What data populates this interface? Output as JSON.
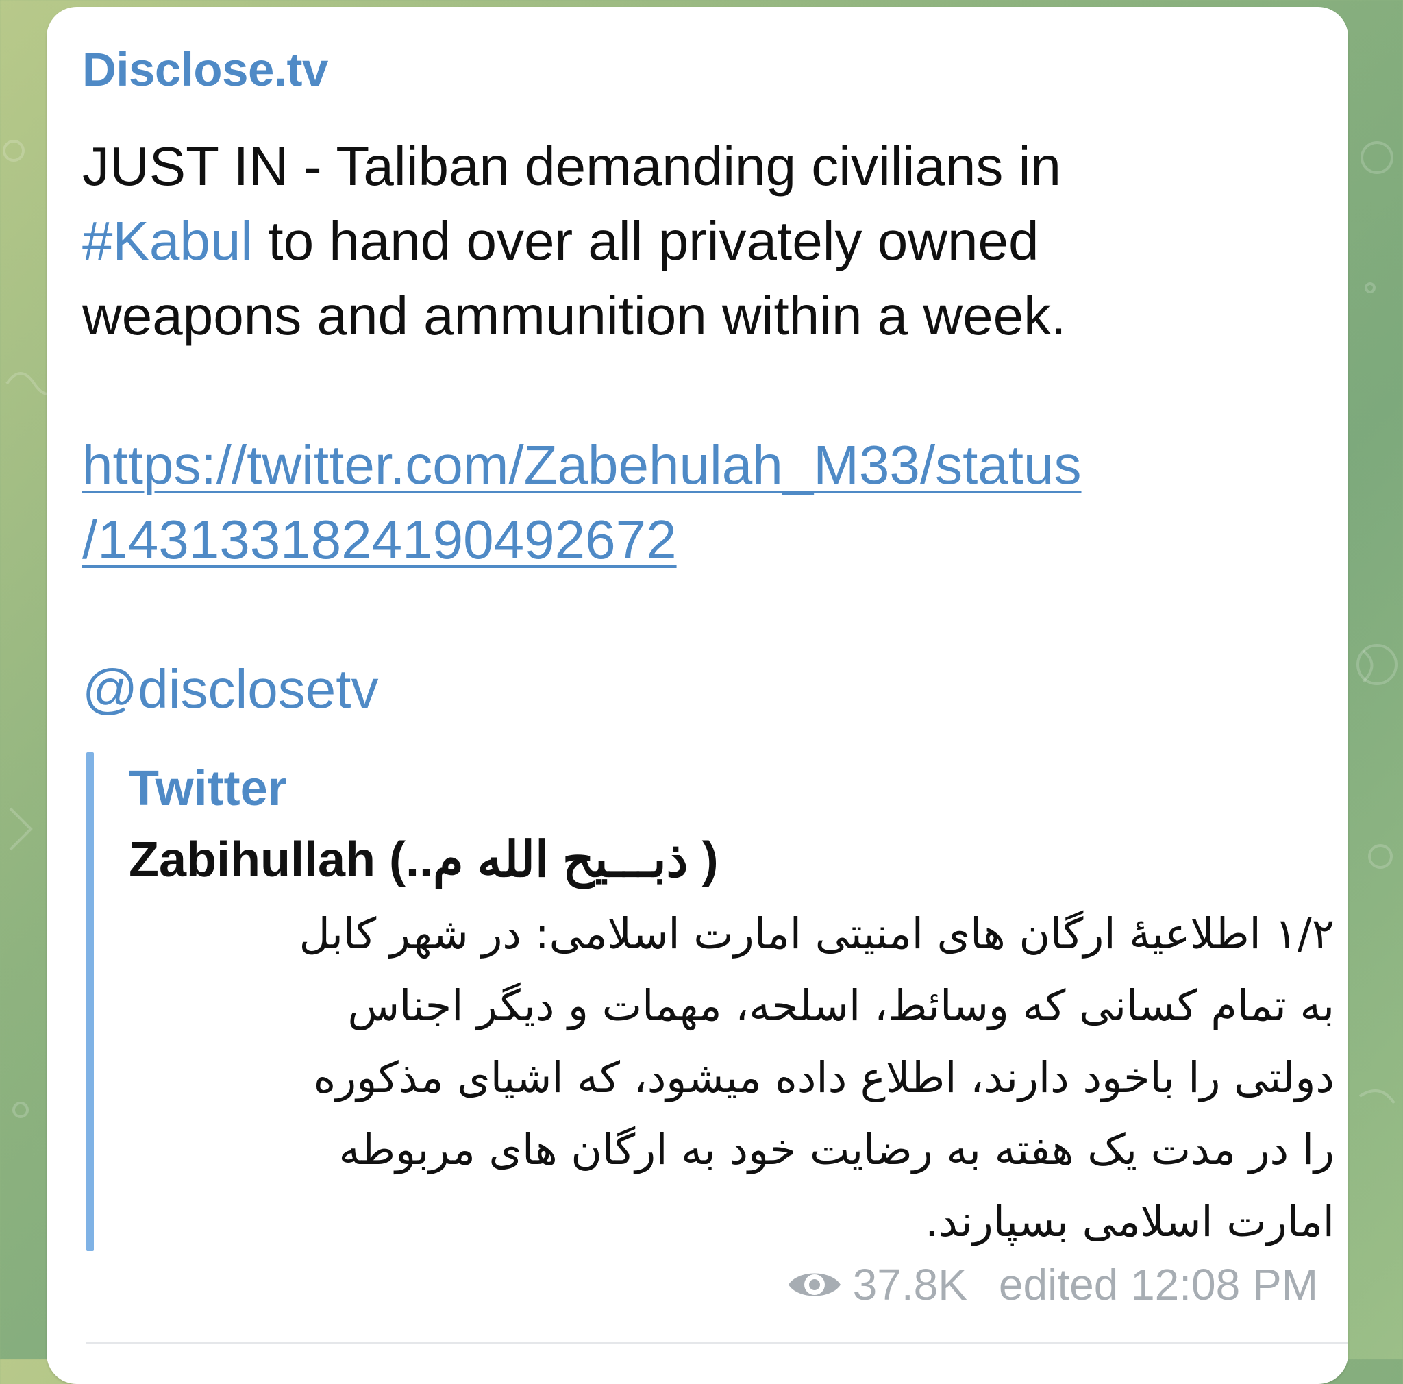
{
  "channel_name": "Disclose.tv",
  "message": {
    "line1": "JUST IN - Taliban demanding civilians in",
    "hashtag": "#Kabul",
    "line2_rest": " to hand over all privately owned",
    "line3": "weapons and ammunition within a week.",
    "link_line1": "https://twitter.com/Zabehulah_M33/status",
    "link_line2": "/1431331824190492672",
    "mention": "@disclosetv"
  },
  "link_preview": {
    "site": "Twitter",
    "author_name": "Zabihullah",
    "author_name_arabic": " (..ذبـــیح الله م )",
    "body_lines": [
      "۱/۲ اطلاعیۀ ارگان های امنیتی امارت اسلامی: در شهر کابل",
      "به تمام کسانی که وسائط، اسلحه، مهمات و دیگر اجناس",
      "دولتی را باخود دارند، اطلاع داده میشود، که اشیای مذکوره",
      "را در مدت یک هفته به رضایت خود به ارگان های مربوطه",
      "امارت اسلامی بسپارند."
    ]
  },
  "footer": {
    "views": "37.8K",
    "edited_time": "edited 12:08 PM",
    "views_icon": "eye-icon"
  },
  "colors": {
    "accent": "#4f8ac6",
    "preview_bar": "#7fb2e5",
    "meta_text": "#a7adb3"
  }
}
